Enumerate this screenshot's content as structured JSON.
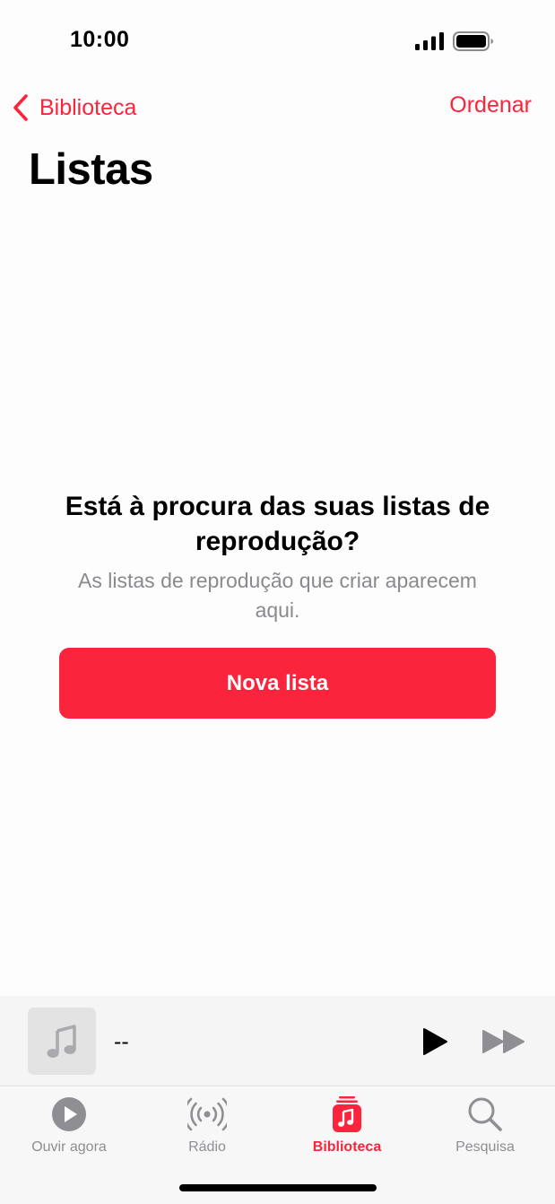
{
  "status_bar": {
    "time": "10:00"
  },
  "nav": {
    "back_label": "Biblioteca",
    "sort_label": "Ordenar"
  },
  "page": {
    "title": "Listas"
  },
  "empty_state": {
    "title": "Está à procura das suas listas de reprodução?",
    "subtitle": "As listas de reprodução que criar aparecem aqui.",
    "button_label": "Nova lista"
  },
  "mini_player": {
    "title": "--"
  },
  "tabs": [
    {
      "label": "Ouvir agora",
      "icon": "play-circle-icon",
      "active": false
    },
    {
      "label": "Rádio",
      "icon": "radio-broadcast-icon",
      "active": false
    },
    {
      "label": "Biblioteca",
      "icon": "library-icon",
      "active": true
    },
    {
      "label": "Pesquisa",
      "icon": "search-icon",
      "active": false
    }
  ],
  "colors": {
    "accent": "#fa243c",
    "secondary_text": "#8a8a8e",
    "tab_inactive": "#8e8e93"
  }
}
